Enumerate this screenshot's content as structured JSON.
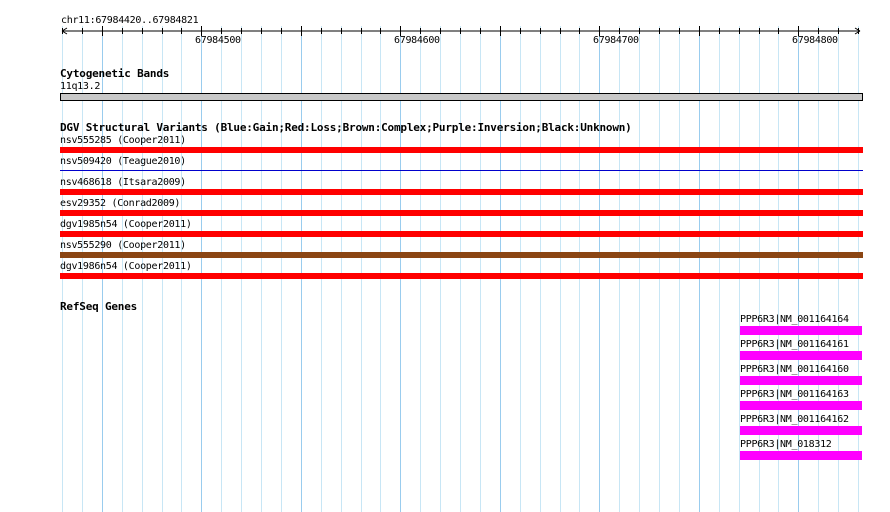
{
  "ruler": {
    "region": "chr11:67984420..67984821",
    "ticks": [
      "67984500",
      "67984600",
      "67984700",
      "67984800"
    ]
  },
  "cytoband": {
    "title": "Cytogenetic Bands",
    "band": "11q13.2"
  },
  "dgv": {
    "title": "DGV Structural Variants (Blue:Gain;Red:Loss;Brown:Complex;Purple:Inversion;Black:Unknown)",
    "variants": [
      {
        "label": "nsv555285 (Cooper2011)",
        "color": "#ff0000"
      },
      {
        "label": "nsv509420 (Teague2010)",
        "color": "#0000cc"
      },
      {
        "label": "nsv468618 (Itsara2009)",
        "color": "#ff0000"
      },
      {
        "label": "esv29352 (Conrad2009)",
        "color": "#ff0000"
      },
      {
        "label": "dgv1985n54 (Cooper2011)",
        "color": "#ff0000"
      },
      {
        "label": "nsv555290 (Cooper2011)",
        "color": "#8b4513"
      },
      {
        "label": "dgv1986n54 (Cooper2011)",
        "color": "#ff0000"
      }
    ]
  },
  "refseq": {
    "title": "RefSeq Genes",
    "color": "#ff00ff",
    "genes": [
      {
        "label": "PPP6R3|NM_001164164"
      },
      {
        "label": "PPP6R3|NM_001164161"
      },
      {
        "label": "PPP6R3|NM_001164160"
      },
      {
        "label": "PPP6R3|NM_001164163"
      },
      {
        "label": "PPP6R3|NM_001164162"
      },
      {
        "label": "PPP6R3|NM_018312"
      }
    ]
  }
}
